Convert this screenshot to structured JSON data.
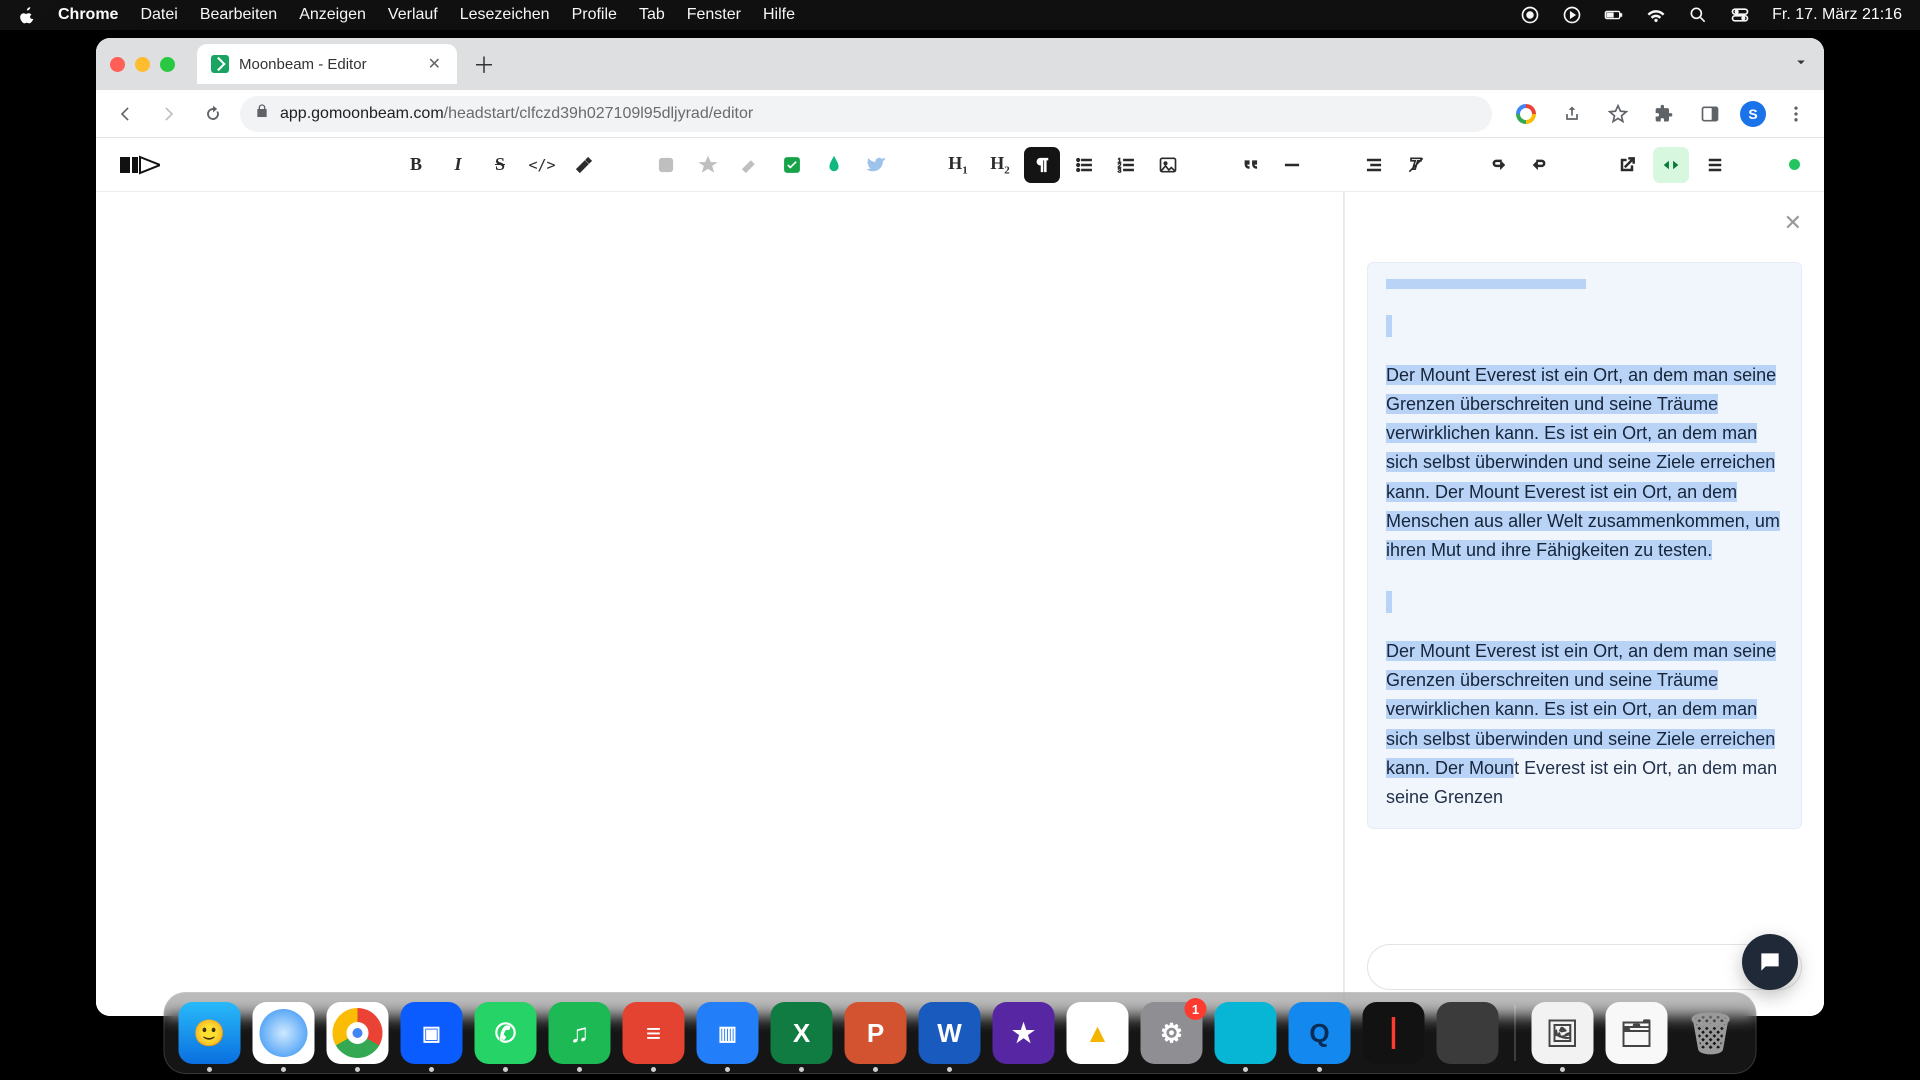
{
  "menubar": {
    "app": "Chrome",
    "items": [
      "Datei",
      "Bearbeiten",
      "Anzeigen",
      "Verlauf",
      "Lesezeichen",
      "Profile",
      "Tab",
      "Fenster",
      "Hilfe"
    ],
    "clock": "Fr. 17. März  21:16"
  },
  "browser": {
    "tab_title": "Moonbeam - Editor",
    "url_host": "app.gomoonbeam.com",
    "url_path": "/headstart/clfczd39h027109l95dljyrad/editor",
    "avatar_letter": "S"
  },
  "toolbar": {
    "h1": "H",
    "h1sub": "1",
    "h2": "H",
    "h2sub": "2",
    "bold": "B",
    "italic": "I",
    "strike": "S",
    "code": "</>"
  },
  "sidepanel": {
    "close": "✕",
    "para1": "Der Mount Everest ist ein Ort, an dem man seine Grenzen überschreiten und seine Träume verwirklichen kann. Es ist ein Ort, an dem man sich selbst überwinden und seine Ziele erreichen kann. Der Mount Everest ist ein Ort, an dem Menschen aus aller Welt zusammenkommen, um ihren Mut und ihre Fähigkeiten zu testen.",
    "para2_sel": "Der Mount Everest ist ein Ort, an dem man seine Grenzen überschreiten und seine Träume verwirklichen kann. Es ist ein Ort, an dem man sich selbst überwinden und seine Ziele erreichen kann. Der Moun",
    "para2_caret": "t",
    "para2_rest": " Everest ist ein Ort, an dem man seine Grenzen",
    "composer_placeholder": ""
  },
  "dock": {
    "settings_badge": "1"
  }
}
